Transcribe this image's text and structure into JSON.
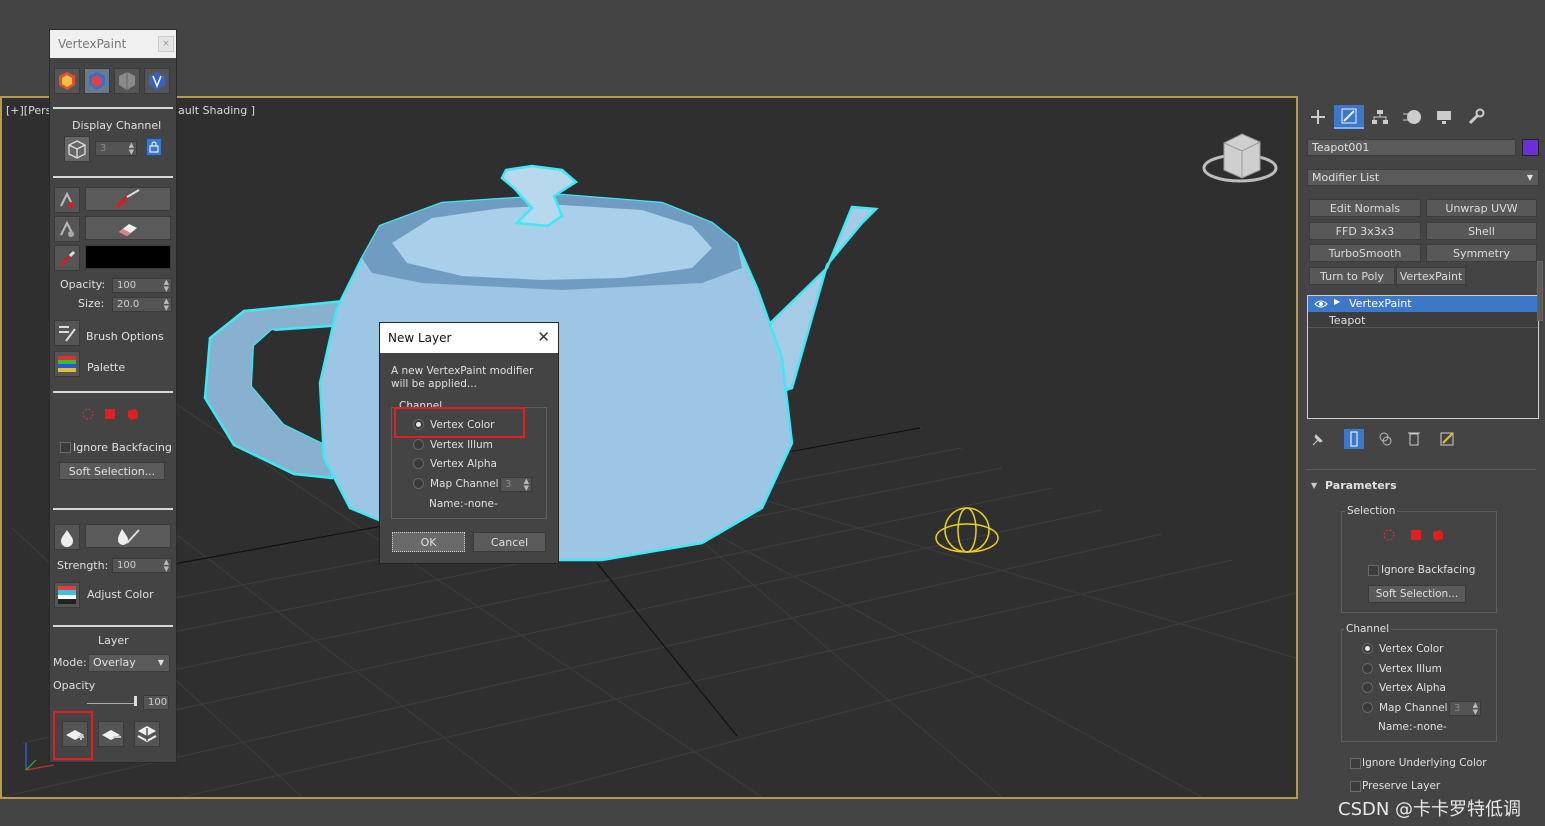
{
  "viewport": {
    "label_left": "[+][Pers",
    "label_right": "ault Shading ]"
  },
  "vertexpaint_panel": {
    "title": "VertexPaint",
    "close": "×",
    "display_channel_label": "Display Channel",
    "display_channel_value": "3",
    "opacity_label": "Opacity:",
    "opacity_value": "100",
    "size_label": "Size:",
    "size_value": "20.0",
    "brush_options": "Brush Options",
    "palette": "Palette",
    "ignore_backfacing": "Ignore Backfacing",
    "soft_selection": "Soft Selection...",
    "strength_label": "Strength:",
    "strength_value": "100",
    "adjust_color": "Adjust Color",
    "layer_label": "Layer",
    "mode_label": "Mode:",
    "mode_value": "Overlay",
    "layer_opacity_label": "Opacity",
    "layer_opacity_value": "100",
    "paint_color": "#000000"
  },
  "dialog": {
    "title": "New Layer",
    "close": "✕",
    "message": "A new VertexPaint modifier will be applied...",
    "channel_group": "Channel",
    "options": [
      "Vertex Color",
      "Vertex Illum",
      "Vertex Alpha",
      "Map Channel"
    ],
    "selected": "Vertex Color",
    "map_channel_value": "3",
    "name_label": "Name:",
    "name_value": "-none-",
    "ok": "OK",
    "cancel": "Cancel"
  },
  "command_panel": {
    "object_name": "Teapot001",
    "object_color": "#6a2fd6",
    "modifier_list": "Modifier List",
    "modifier_buttons": [
      "Edit Normals",
      "Unwrap UVW",
      "FFD 3x3x3",
      "Shell",
      "TurboSmooth",
      "Symmetry",
      "Turn to Poly",
      "VertexPaint"
    ],
    "stack_items": [
      "VertexPaint",
      "Teapot"
    ],
    "parameters_title": "Parameters",
    "selection_group": "Selection",
    "ignore_backfacing": "Ignore Backfacing",
    "soft_selection": "Soft Selection...",
    "channel_group": "Channel",
    "channel_options": [
      "Vertex Color",
      "Vertex Illum",
      "Vertex Alpha",
      "Map Channel"
    ],
    "map_channel_value": "3",
    "name_label": "Name:",
    "name_value": "-none-",
    "ignore_underlying": "Ignore Underlying Color",
    "preserve_layer": "Preserve Layer"
  },
  "watermark": "CSDN @卡卡罗特低调",
  "colors": {
    "selection_outline": "#3ee8f5",
    "teapot": "#9cc6e4",
    "highlight_red": "#e02020",
    "viewport_border": "#b79a4e",
    "stack_selected": "#3d78c8"
  }
}
